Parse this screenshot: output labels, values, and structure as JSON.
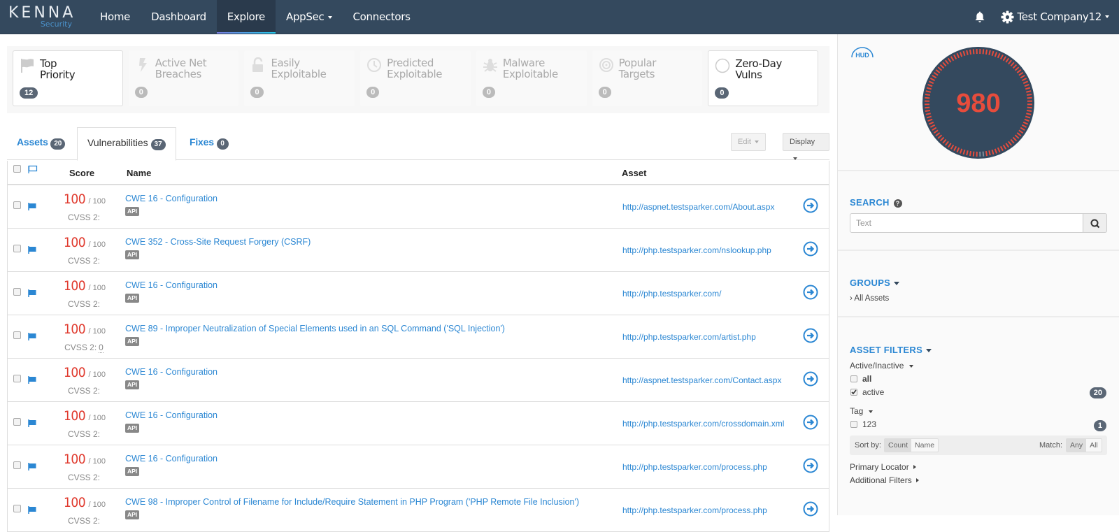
{
  "nav": {
    "logo_main": "KENNA",
    "logo_sub": "Security",
    "items": [
      {
        "label": "Home",
        "active": false,
        "dropdown": false
      },
      {
        "label": "Dashboard",
        "active": false,
        "dropdown": false
      },
      {
        "label": "Explore",
        "active": true,
        "dropdown": false
      },
      {
        "label": "AppSec",
        "active": false,
        "dropdown": true
      },
      {
        "label": "Connectors",
        "active": false,
        "dropdown": false
      }
    ],
    "notifications_icon": "bell-icon",
    "company": "Test Company12",
    "company_icon": "gear-icon"
  },
  "categories": [
    {
      "label_1": "Top",
      "label_2": "Priority",
      "count": "12",
      "icon": "flag-icon",
      "enabled": true
    },
    {
      "label_1": "Active Net",
      "label_2": "Breaches",
      "count": "0",
      "icon": "lightning-icon",
      "enabled": false
    },
    {
      "label_1": "Easily",
      "label_2": "Exploitable",
      "count": "0",
      "icon": "unlock-icon",
      "enabled": false
    },
    {
      "label_1": "Predicted",
      "label_2": "Exploitable",
      "count": "0",
      "icon": "clock-icon",
      "enabled": false
    },
    {
      "label_1": "Malware",
      "label_2": "Exploitable",
      "count": "0",
      "icon": "bug-icon",
      "enabled": false
    },
    {
      "label_1": "Popular",
      "label_2": "Targets",
      "count": "0",
      "icon": "target-icon",
      "enabled": false
    },
    {
      "label_1": "Zero-Day",
      "label_2": "Vulns",
      "count": "0",
      "icon": "circle-icon",
      "enabled": true
    }
  ],
  "tabs": [
    {
      "label": "Assets",
      "count": "20",
      "active": false
    },
    {
      "label": "Vulnerabilities",
      "count": "37",
      "active": true
    },
    {
      "label": "Fixes",
      "count": "0",
      "active": false
    }
  ],
  "toolbar": {
    "edit_label": "Edit",
    "display_label": "Display"
  },
  "table": {
    "columns": {
      "score": "Score",
      "name": "Name",
      "asset": "Asset"
    },
    "score_max": "/ 100",
    "cvss_label": "CVSS 2:",
    "tag_label": "API",
    "rows": [
      {
        "score": "100",
        "cvss": "",
        "name": "CWE 16 - Configuration",
        "asset": "http://aspnet.testsparker.com/About.aspx"
      },
      {
        "score": "100",
        "cvss": "",
        "name": "CWE 352 - Cross-Site Request Forgery (CSRF)",
        "asset": "http://php.testsparker.com/nslookup.php"
      },
      {
        "score": "100",
        "cvss": "",
        "name": "CWE 16 - Configuration",
        "asset": "http://php.testsparker.com/"
      },
      {
        "score": "100",
        "cvss": "0",
        "name": "CWE 89 - Improper Neutralization of Special Elements used in an SQL Command ('SQL Injection')",
        "asset": "http://php.testsparker.com/artist.php"
      },
      {
        "score": "100",
        "cvss": "",
        "name": "CWE 16 - Configuration",
        "asset": "http://aspnet.testsparker.com/Contact.aspx"
      },
      {
        "score": "100",
        "cvss": "",
        "name": "CWE 16 - Configuration",
        "asset": "http://php.testsparker.com/crossdomain.xml"
      },
      {
        "score": "100",
        "cvss": "",
        "name": "CWE 16 - Configuration",
        "asset": "http://php.testsparker.com/process.php"
      },
      {
        "score": "100",
        "cvss": "",
        "name": "CWE 98 - Improper Control of Filename for Include/Require Statement in PHP Program ('PHP Remote File Inclusion')",
        "asset": "http://php.testsparker.com/process.php"
      }
    ]
  },
  "sidebar": {
    "hud_label": "HUD",
    "risk_score": "980",
    "risk_score_fraction": 0.98,
    "search": {
      "title": "SEARCH",
      "placeholder": "Text",
      "value": ""
    },
    "groups": {
      "title": "GROUPS",
      "item": "All Assets"
    },
    "asset_filters": {
      "title": "ASSET FILTERS",
      "active_inactive": {
        "title": "Active/Inactive",
        "options": [
          {
            "label": "all",
            "checked": false,
            "count": ""
          },
          {
            "label": "active",
            "checked": true,
            "count": "20"
          }
        ]
      },
      "tag": {
        "title": "Tag",
        "options": [
          {
            "label": "123",
            "checked": false,
            "count": "1"
          }
        ]
      },
      "sort_label": "Sort by:",
      "sort_options": [
        "Count",
        "Name"
      ],
      "sort_selected": "Count",
      "match_label": "Match:",
      "match_options": [
        "Any",
        "All"
      ],
      "match_selected": "Any",
      "primary_locator": "Primary Locator",
      "additional_filters": "Additional Filters"
    }
  },
  "colors": {
    "navbar": "#34495e",
    "link": "#2b87d3",
    "score_red": "#e03a2e",
    "gauge_bg": "#34495e",
    "badge": "#5a6675"
  }
}
